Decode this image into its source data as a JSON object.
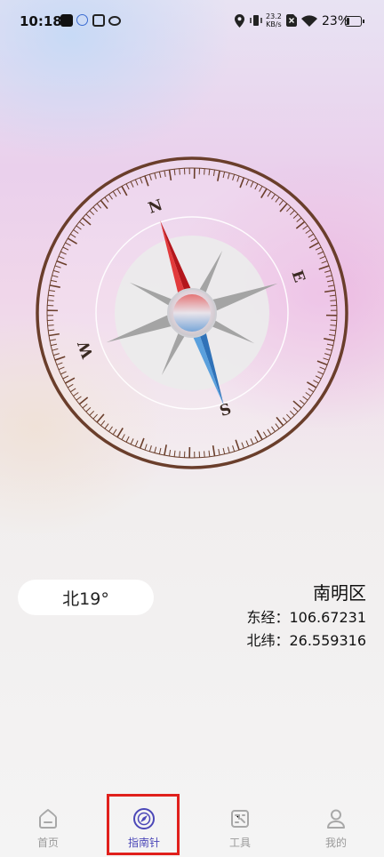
{
  "status_bar": {
    "time": "10:18",
    "net_speed_value": "23.2",
    "net_speed_unit": "KB/s",
    "battery": "23%",
    "battery_level": 0.23
  },
  "compass": {
    "cardinals": {
      "north": "N",
      "east": "E",
      "south": "S",
      "west": "W"
    },
    "needle_heading_deg": 19,
    "colors": {
      "ring": "#6a3e2b",
      "north_needle": "#d8262a",
      "south_needle": "#3b88d0",
      "star": "#9b9b9b"
    }
  },
  "heading": {
    "text": "北19°"
  },
  "location": {
    "district": "南明区",
    "longitude_label": "东经：106.67231",
    "latitude_label": "北纬：26.559316"
  },
  "nav": {
    "items": [
      {
        "label": "首页",
        "icon": "home-icon"
      },
      {
        "label": "指南针",
        "icon": "compass-icon"
      },
      {
        "label": "工具",
        "icon": "toolbox-icon"
      },
      {
        "label": "我的",
        "icon": "person-icon"
      }
    ],
    "active_index": 1,
    "active_color": "#4b47b8",
    "highlight_color": "#e0201c"
  }
}
